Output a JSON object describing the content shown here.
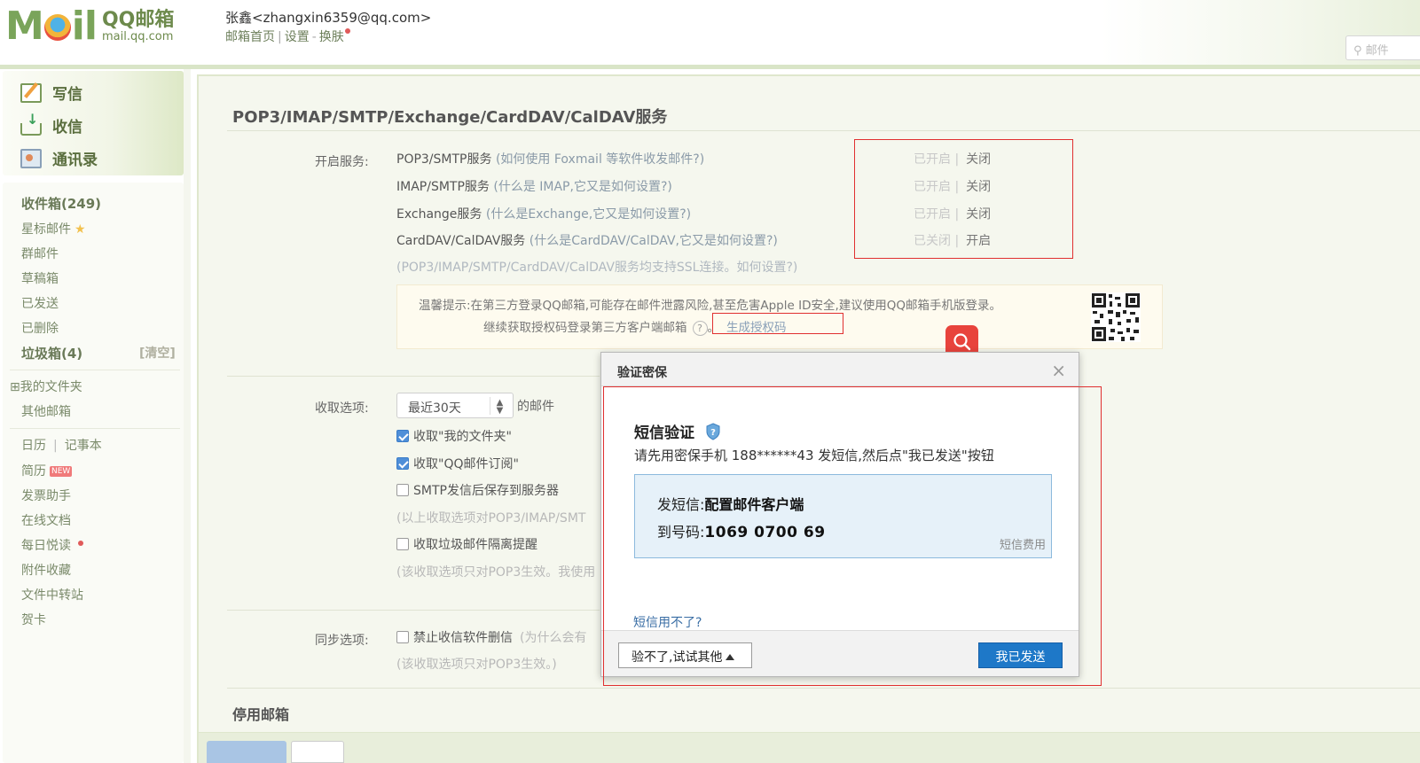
{
  "header": {
    "logo_moil": "M il",
    "logo_qq": "QQ邮箱",
    "logo_domain": "mail.qq.com",
    "user": "张鑫<zhangxin6359@qq.com>",
    "links": [
      "邮箱首页",
      "设置",
      "换肤"
    ],
    "search_placeholder": "邮件"
  },
  "sidebar": {
    "actions": [
      "写信",
      "收信",
      "通讯录"
    ],
    "folders": {
      "inbox": "收件箱(249)",
      "starred": "星标邮件",
      "group": "群邮件",
      "drafts": "草稿箱",
      "sent": "已发送",
      "deleted": "已删除",
      "spam": "垃圾箱(4)",
      "spam_clear": "[清空]",
      "my_folders": "⊞我的文件夹",
      "other_mailbox": "其他邮箱",
      "calendar": "日历",
      "notes": "记事本",
      "resume": "简历",
      "resume_badge": "NEW",
      "invoice": "发票助手",
      "docs": "在线文档",
      "daily_read": "每日悦读",
      "attach": "附件收藏",
      "transfer": "文件中转站",
      "cards": "贺卡"
    }
  },
  "main": {
    "title": "POP3/IMAP/SMTP/Exchange/CardDAV/CalDAV服务",
    "open_label": "开启服务:",
    "services": [
      {
        "name": "POP3/SMTP服务",
        "hint": "(如何使用 Foxmail 等软件收发邮件?)",
        "state": "已开启 |",
        "action": "关闭"
      },
      {
        "name": "IMAP/SMTP服务",
        "hint": "(什么是 IMAP,它又是如何设置?)",
        "state": "已开启 |",
        "action": "关闭"
      },
      {
        "name": "Exchange服务",
        "hint": "(什么是Exchange,它又是如何设置?)",
        "state": "已开启 |",
        "action": "关闭"
      },
      {
        "name": "CardDAV/CalDAV服务",
        "hint": "(什么是CardDAV/CalDAV,它又是如何设置?)",
        "state": "已关闭 |",
        "action": "开启"
      }
    ],
    "ssl_note": "(POP3/IMAP/SMTP/CardDAV/CalDAV服务均支持SSL连接。如何设置?)",
    "warn_line1": "温馨提示:在第三方登录QQ邮箱,可能存在邮件泄露风险,甚至危害Apple ID安全,建议使用QQ邮箱手机版登录。",
    "warn_line2": "继续获取授权码登录第三方客户端邮箱",
    "warn_q": "?",
    "warn_sep": "。",
    "gen_code": "生成授权码",
    "recv_label": "收取选项:",
    "recv_range": "最近30天",
    "recv_suffix": "的邮件",
    "cb_my_folder": "收取\"我的文件夹\"",
    "cb_subscribe": "收取\"QQ邮件订阅\"",
    "cb_smtp_save": "SMTP发信后保存到服务器",
    "note_recv": "(以上收取选项对POP3/IMAP/SMT",
    "cb_spam": "收取垃圾邮件隔离提醒",
    "note_pop3": "(该收取选项只对POP3生效。我使用",
    "sync_label": "同步选项:",
    "cb_no_delete": "禁止收信软件删信",
    "cb_no_delete_hint": "(为什么会有",
    "note_sync": "(该收取选项只对POP3生效。)",
    "stop_title": "停用邮箱"
  },
  "dialog": {
    "title": "验证密保",
    "close": "×",
    "heading": "短信验证",
    "desc": "请先用密保手机 188******43 发短信,然后点\"我已发送\"按钮",
    "send_label": "发短信:",
    "send_value": "配置邮件客户端",
    "to_label": "到号码:",
    "to_value": "1069 0700 69",
    "fee": "短信费用",
    "fail_link": "短信用不了?",
    "btn_other": "验不了,试试其他",
    "btn_sent": "我已发送"
  },
  "colors": {
    "theme_green": "#7aa45a",
    "primary_button": "#1e78c8",
    "annotation_red": "#e03030",
    "search_red": "#e8433c"
  }
}
